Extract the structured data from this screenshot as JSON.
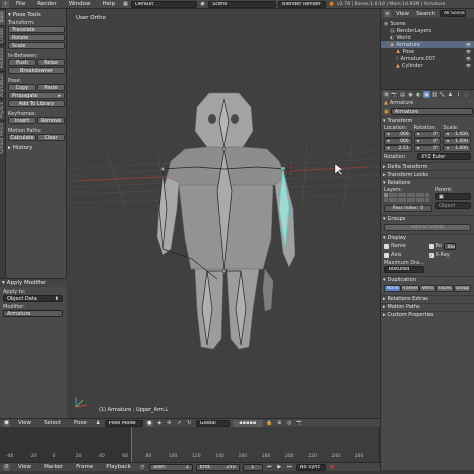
{
  "topbar": {
    "menus": [
      "File",
      "Render",
      "Window",
      "Help"
    ],
    "layout": "Default",
    "scene": "Scene",
    "engine": "Blender Render",
    "stats": "v2.78 | Bones:1:0:19 | Mem:14.93M | Armature"
  },
  "toolshelf": {
    "tabs": [
      "Tools",
      "Create",
      "Relations",
      "Animation",
      "Physics",
      "Grease Pencil"
    ],
    "panel_title": "Pose Tools",
    "transform_label": "Transform:",
    "transform_buttons": [
      "Translate",
      "Rotate",
      "Scale"
    ],
    "inbetween_label": "In-Between:",
    "push": "Push",
    "relax": "Relax",
    "breakdowner": "Breakdowner",
    "pose_label": "Pose:",
    "copy": "Copy",
    "paste": "Paste",
    "propagate": "Propagate",
    "add_to_library": "Add To Library",
    "keyframes_label": "Keyframes:",
    "insert": "Insert",
    "remove": "Remove",
    "motion_paths_label": "Motion Paths:",
    "calculate": "Calculate",
    "clear": "Clear",
    "history": "History"
  },
  "operator": {
    "title": "Apply Modifier",
    "apply_to_label": "Apply to:",
    "apply_to_value": "Object Data",
    "modifier_label": "Modifier:",
    "modifier_value": "Armature"
  },
  "viewport": {
    "label": "User Ortho",
    "status": "(1) Armature : Upper_Arm.L"
  },
  "viewport_header": {
    "menus": [
      "View",
      "Select",
      "Pose"
    ],
    "mode": "Pose Mode",
    "orientation": "Global"
  },
  "timeline": {
    "ticks": [
      "-40",
      "-20",
      "0",
      "20",
      "40",
      "60",
      "80",
      "100",
      "120",
      "140",
      "160",
      "180",
      "200",
      "220",
      "240",
      "260"
    ],
    "menus": [
      "View",
      "Marker",
      "Frame",
      "Playback"
    ],
    "start_label": "Start:",
    "start_value": "1",
    "end_label": "End:",
    "end_value": "250",
    "current": "1",
    "sync": "No Sync"
  },
  "outliner": {
    "view": "View",
    "search": "Search",
    "all_scenes": "All Scenes",
    "items": [
      {
        "label": "Scene",
        "indent": 0
      },
      {
        "label": "RenderLayers",
        "indent": 1
      },
      {
        "label": "World",
        "indent": 1
      },
      {
        "label": "Armature",
        "indent": 1
      },
      {
        "label": "Pose",
        "indent": 2
      },
      {
        "label": "Armature.007",
        "indent": 2
      },
      {
        "label": "Cylinder",
        "indent": 2
      }
    ]
  },
  "properties": {
    "breadcrumb": "Armature",
    "object_name": "Armature",
    "transform_title": "Transform",
    "location_label": "Location:",
    "rotation_label": "Rotation:",
    "scale_label": "Scale:",
    "location": [
      ".000",
      ".000",
      "2.53"
    ],
    "rotation": [
      "0°",
      "0°",
      "0°"
    ],
    "scale": [
      "1.000",
      "1.000",
      "1.000"
    ],
    "rotation_mode_label": "Rotation",
    "rotation_mode": "XYZ Euler",
    "delta_transform": "Delta Transform",
    "transform_locks": "Transform Locks",
    "relations": "Relations",
    "layers_label": "Layers:",
    "parent_label": "Parent:",
    "parent_type": "Object",
    "pass_index_label": "Pass Index:",
    "pass_index": "0",
    "groups": "Groups",
    "add_to_group": "Add to Group",
    "display": "Display",
    "name_label": "Name",
    "axis_label": "Axis",
    "bounds_label": "Bo",
    "xray_label": "X-Ray",
    "box_label": "Box",
    "max_draw_label": "Maximum Dra...",
    "max_draw_value": "Textured",
    "duplication": "Duplication",
    "dup_tabs": [
      "None",
      "Frames",
      "Verts",
      "Faces",
      "Group"
    ],
    "relations_extras": "Relations Extras",
    "motion_paths": "Motion Paths",
    "custom_properties": "Custom Properties",
    "accent": "#5680c2"
  }
}
